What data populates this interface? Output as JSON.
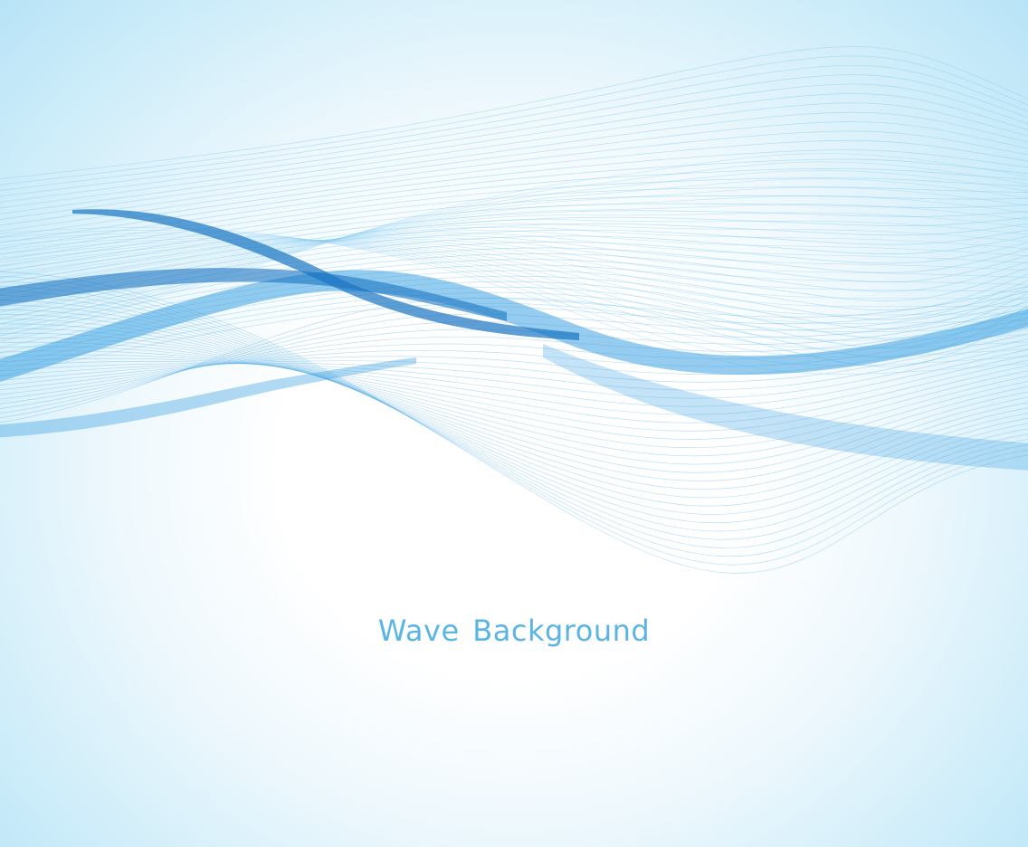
{
  "caption": {
    "text": "Wave Background",
    "color": "#5ab4e5"
  },
  "colors": {
    "background_center": "#ffffff",
    "background_edge": "#b8e3f7",
    "wave_light": "#8ecff1",
    "wave_mid": "#3ea3e2",
    "wave_dark": "#1a75c2"
  }
}
